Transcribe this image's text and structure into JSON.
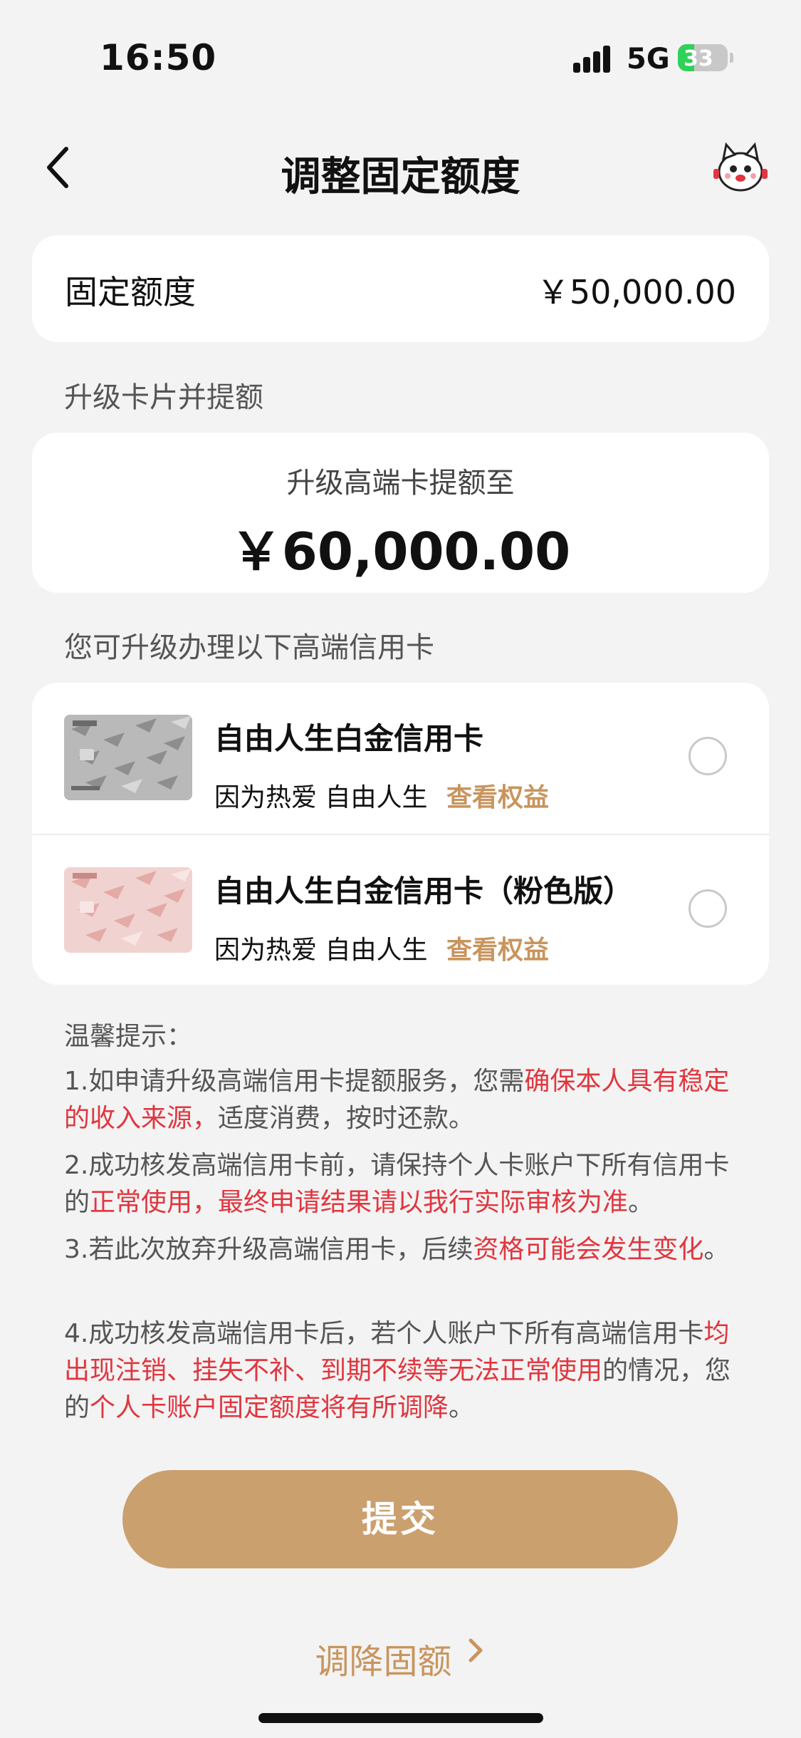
{
  "status_bar": {
    "time": "16:50",
    "network": "5G",
    "battery_level": 33,
    "battery_text": "33"
  },
  "nav": {
    "title": "调整固定额度",
    "back_icon": "chevron-left-icon",
    "mascot_icon": "mascot-avatar-icon"
  },
  "fixed_limit": {
    "label": "固定额度",
    "value": "￥50,000.00"
  },
  "upgrade_section": {
    "label": "升级卡片并提额",
    "subtitle": "升级高端卡提额至",
    "amount": "￥60,000.00"
  },
  "cards_section": {
    "label": "您可升级办理以下高端信用卡",
    "cards": [
      {
        "name": "自由人生白金信用卡",
        "desc": "因为热爱 自由人生",
        "link": "查看权益",
        "selected": false
      },
      {
        "name": "自由人生白金信用卡（粉色版）",
        "desc": "因为热爱 自由人生",
        "link": "查看权益",
        "selected": false
      }
    ]
  },
  "tips": {
    "title": "温馨提示：",
    "t1a": "1.如申请升级高端信用卡提额服务，您需",
    "t1b": "确保本人具有稳定的收入来源，",
    "t1c": "适度消费，按时还款。",
    "t2a": "2.成功核发高端信用卡前，请保持个人卡账户下所有信用卡的",
    "t2b": "正常使用，最终申请结果请以我行实际审核为准",
    "t2c": "。",
    "t3a": "3.若此次放弃升级高端信用卡，后续",
    "t3b": "资格可能会发生变化",
    "t3c": "。",
    "t4a": "4.成功核发高端信用卡后，若个人账户下所有高端信用卡",
    "t4b": "均出现注销、挂失不补、到期不续等无法正常使用",
    "t4c": "的情况，您的",
    "t4d": "个人卡账户固定额度将有所调降",
    "t4e": "。"
  },
  "actions": {
    "submit": "提交",
    "lower_limit": "调降固额"
  },
  "colors": {
    "accent": "#cba06f",
    "link": "#c8955e",
    "warning": "#e0363f",
    "background": "#f3f3f3"
  }
}
